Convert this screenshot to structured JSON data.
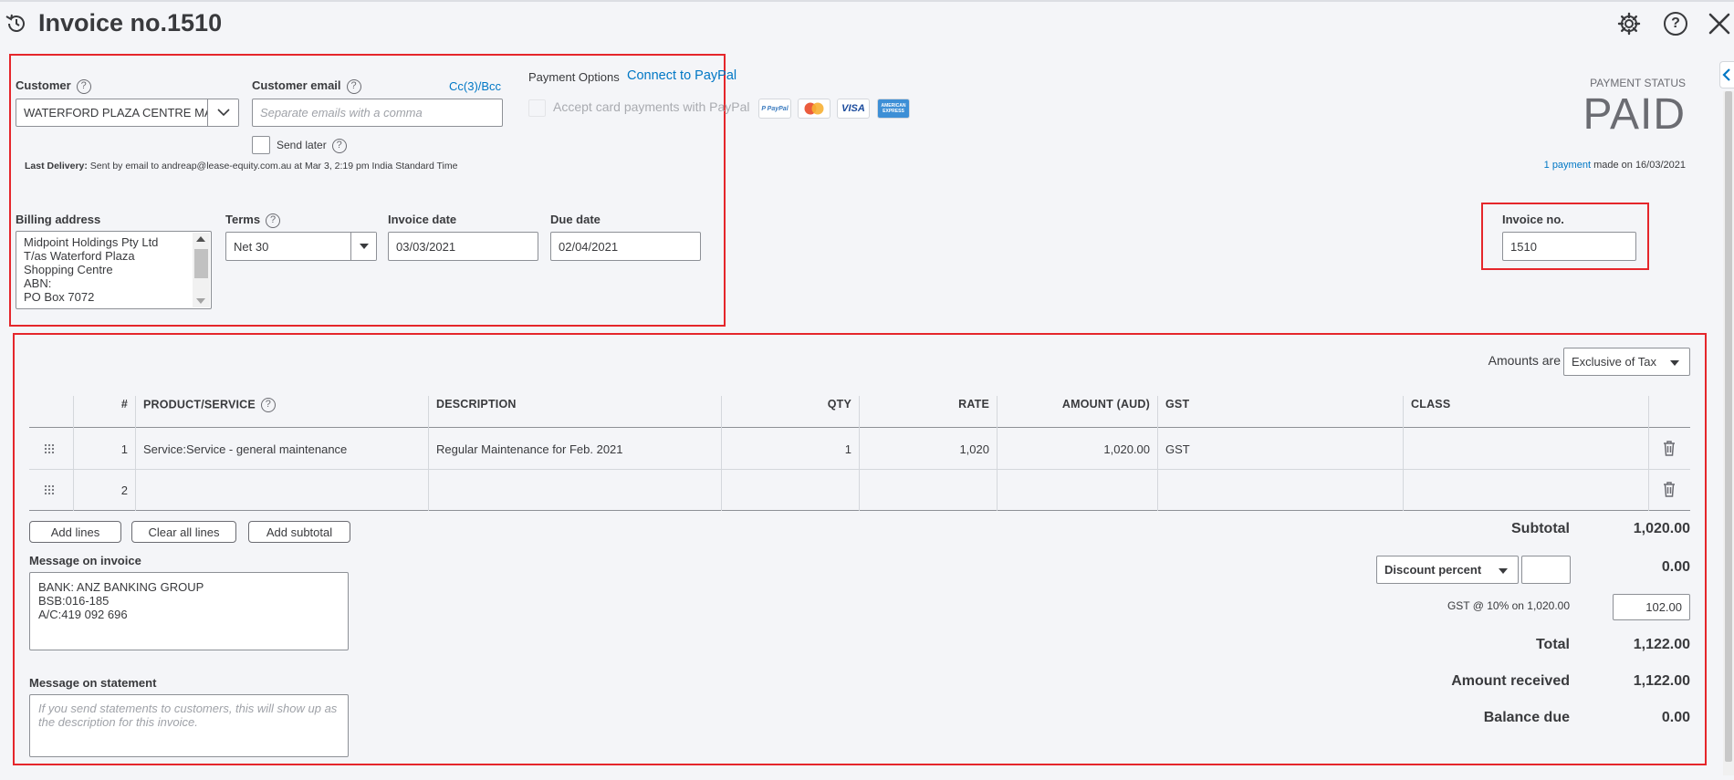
{
  "header": {
    "title": "Invoice no.1510",
    "icons": [
      "history-icon",
      "gear-icon",
      "help-icon",
      "close-icon"
    ]
  },
  "customer": {
    "label": "Customer",
    "value": "WATERFORD PLAZA CENTRE MA",
    "email_label": "Customer email",
    "email_placeholder": "Separate emails with a comma",
    "cc_bcc": "Cc(3)/Bcc",
    "send_later": "Send later",
    "last_delivery_label": "Last Delivery:",
    "last_delivery_text": "Sent by email to andreap@lease-equity.com.au at Mar 3, 2:19 pm India Standard Time"
  },
  "payment_options": {
    "label": "Payment Options",
    "connect": "Connect to PayPal",
    "accept": "Accept card payments with PayPal",
    "cards": [
      "P PayPal",
      "MasterCard",
      "VISA",
      "AMERICAN EXPRESS"
    ]
  },
  "payment_status": {
    "label": "PAYMENT STATUS",
    "value": "PAID",
    "payment_link": "1 payment",
    "made_on": "made on 16/03/2021"
  },
  "billing": {
    "label": "Billing address",
    "value": "Midpoint Holdings Pty Ltd\nT/as Waterford Plaza\nShopping Centre\nABN:\nPO Box 7072"
  },
  "terms": {
    "label": "Terms",
    "value": "Net 30"
  },
  "invoice_date": {
    "label": "Invoice date",
    "value": "03/03/2021"
  },
  "due_date": {
    "label": "Due date",
    "value": "02/04/2021"
  },
  "invoice_no": {
    "label": "Invoice no.",
    "value": "1510"
  },
  "amounts_are": {
    "label": "Amounts are",
    "value": "Exclusive of Tax"
  },
  "table": {
    "headers": [
      "#",
      "PRODUCT/SERVICE",
      "DESCRIPTION",
      "QTY",
      "RATE",
      "AMOUNT (AUD)",
      "GST",
      "CLASS"
    ],
    "rows": [
      {
        "num": "1",
        "product": "Service:Service - general maintenance",
        "description": "Regular Maintenance for Feb. 2021",
        "qty": "1",
        "rate": "1,020",
        "amount": "1,020.00",
        "gst": "GST",
        "class": ""
      },
      {
        "num": "2",
        "product": "",
        "description": "",
        "qty": "",
        "rate": "",
        "amount": "",
        "gst": "",
        "class": ""
      }
    ]
  },
  "buttons": {
    "add_lines": "Add lines",
    "clear_all_lines": "Clear all lines",
    "add_subtotal": "Add subtotal"
  },
  "message_invoice": {
    "label": "Message on invoice",
    "value": "BANK: ANZ BANKING GROUP\nBSB:016-185\nA/C:419 092 696"
  },
  "message_statement": {
    "label": "Message on statement",
    "placeholder": "If you send statements to customers, this will show up as the description for this invoice."
  },
  "totals": {
    "subtotal_label": "Subtotal",
    "subtotal_value": "1,020.00",
    "discount_label": "Discount percent",
    "discount_value": "0.00",
    "gst_label": "GST @ 10% on 1,020.00",
    "gst_value": "102.00",
    "total_label": "Total",
    "total_value": "1,122.00",
    "received_label": "Amount received",
    "received_value": "1,122.00",
    "balance_label": "Balance due",
    "balance_value": "0.00"
  },
  "colors": {
    "accent": "#0077c5",
    "highlight": "#e5262b",
    "text": "#393a3d"
  }
}
